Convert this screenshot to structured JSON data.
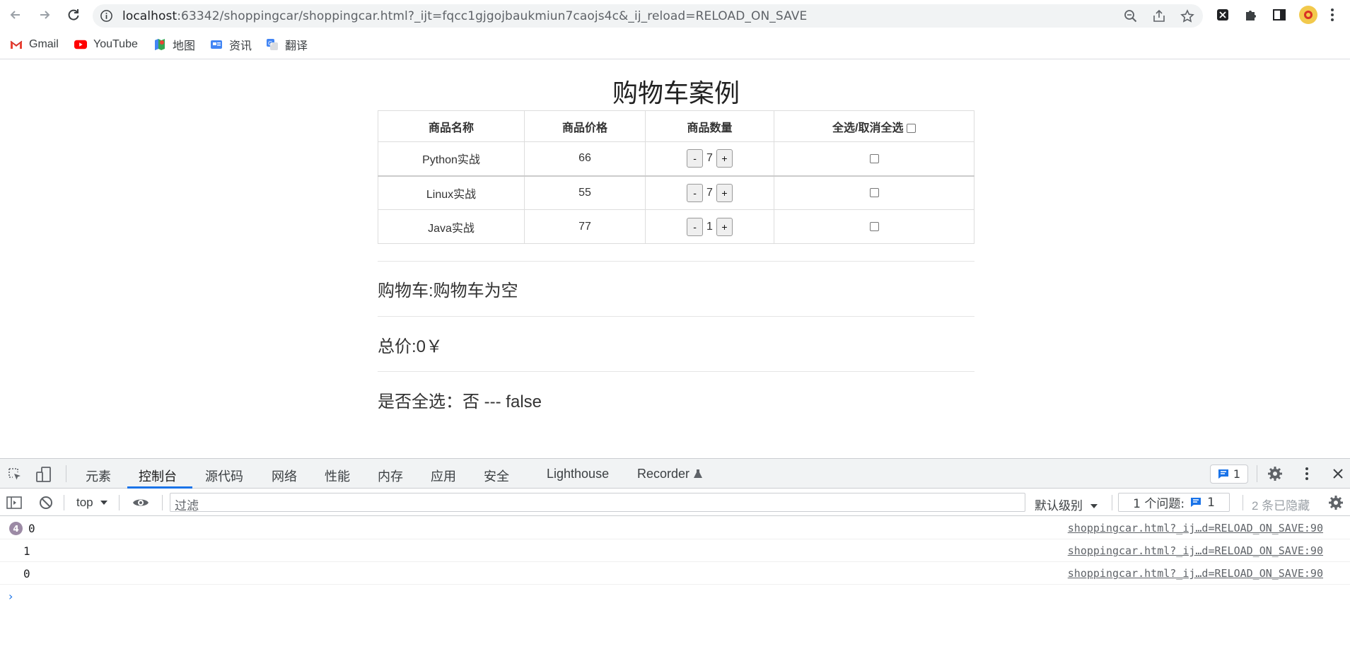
{
  "browser": {
    "url_host": "localhost",
    "url_rest": ":63342/shoppingcar/shoppingcar.html?_ijt=fqcc1gjgojbaukmiun7caojs4c&_ij_reload=RELOAD_ON_SAVE",
    "bookmarks": [
      {
        "label": "Gmail",
        "icon": "gmail-icon"
      },
      {
        "label": "YouTube",
        "icon": "youtube-icon"
      },
      {
        "label": "地图",
        "icon": "maps-icon"
      },
      {
        "label": "资讯",
        "icon": "news-icon"
      },
      {
        "label": "翻译",
        "icon": "translate-icon"
      }
    ]
  },
  "page": {
    "title": "购物车案例",
    "headers": [
      "商品名称",
      "商品价格",
      "商品数量",
      "全选/取消全选"
    ],
    "items": [
      {
        "name": "Python实战",
        "price": "66",
        "count": "7"
      },
      {
        "name": "Linux实战",
        "price": "55",
        "count": "7"
      },
      {
        "name": "Java实战",
        "price": "77",
        "count": "1"
      }
    ],
    "minus_label": "-",
    "plus_label": "+",
    "cart_line": "购物车:购物车为空",
    "total_line": "总价:0￥",
    "select_all_line": "是否全选：否 --- false"
  },
  "devtools": {
    "tabs": [
      "元素",
      "控制台",
      "源代码",
      "网络",
      "性能",
      "内存",
      "应用",
      "安全",
      "Lighthouse",
      "Recorder"
    ],
    "active_tab": "控制台",
    "message_count": "1",
    "context": "top",
    "filter_placeholder": "过滤",
    "level": "默认级别",
    "issues_label": "1 个问题:",
    "issues_count": "1",
    "hidden_label": "2 条已隐藏",
    "logs": [
      {
        "value": "0",
        "repeat": "4",
        "source": "shoppingcar.html?_ij…d=RELOAD_ON_SAVE:90"
      },
      {
        "value": "1",
        "source": "shoppingcar.html?_ij…d=RELOAD_ON_SAVE:90"
      },
      {
        "value": "0",
        "source": "shoppingcar.html?_ij…d=RELOAD_ON_SAVE:90"
      }
    ],
    "prompt": "›"
  }
}
